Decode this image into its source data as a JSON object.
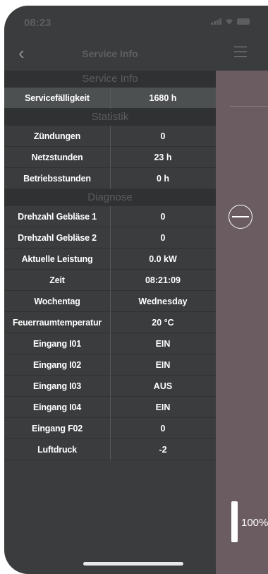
{
  "status_bar": {
    "time": "08:23"
  },
  "nav": {
    "title": "Service Info"
  },
  "sections": [
    {
      "title": "Service Info",
      "rows": [
        {
          "label": "Servicefälligkeit",
          "value": "1680 h"
        }
      ]
    },
    {
      "title": "Statistik",
      "rows": [
        {
          "label": "Zündungen",
          "value": "0"
        },
        {
          "label": "Netzstunden",
          "value": "23 h"
        },
        {
          "label": "Betriebsstunden",
          "value": "0 h"
        }
      ]
    },
    {
      "title": "Diagnose",
      "rows": [
        {
          "label": "Drehzahl Gebläse 1",
          "value": "0"
        },
        {
          "label": "Drehzahl Gebläse 2",
          "value": "0"
        },
        {
          "label": "Aktuelle Leistung",
          "value": "0.0 kW"
        },
        {
          "label": "Zeit",
          "value": "08:21:09"
        },
        {
          "label": "Wochentag",
          "value": "Wednesday"
        },
        {
          "label": "Feuerraumtemperatur",
          "value": "20 °C"
        },
        {
          "label": "Eingang I01",
          "value": "EIN"
        },
        {
          "label": "Eingang I02",
          "value": "EIN"
        },
        {
          "label": "Eingang I03",
          "value": "AUS"
        },
        {
          "label": "Eingang I04",
          "value": "EIN"
        },
        {
          "label": "Eingang F02",
          "value": "0"
        },
        {
          "label": "Luftdruck",
          "value": "-2"
        }
      ]
    }
  ],
  "side_panel": {
    "level_text": "100%"
  },
  "colors": {
    "background": "#3a3c3d",
    "section_header": "#2f3132",
    "side_panel": "#6b5c61",
    "text": "#ffffff"
  },
  "icons": [
    "back-chevron-icon",
    "hamburger-menu-icon",
    "minus-circle-icon",
    "signal-icon",
    "wifi-icon",
    "battery-icon"
  ]
}
